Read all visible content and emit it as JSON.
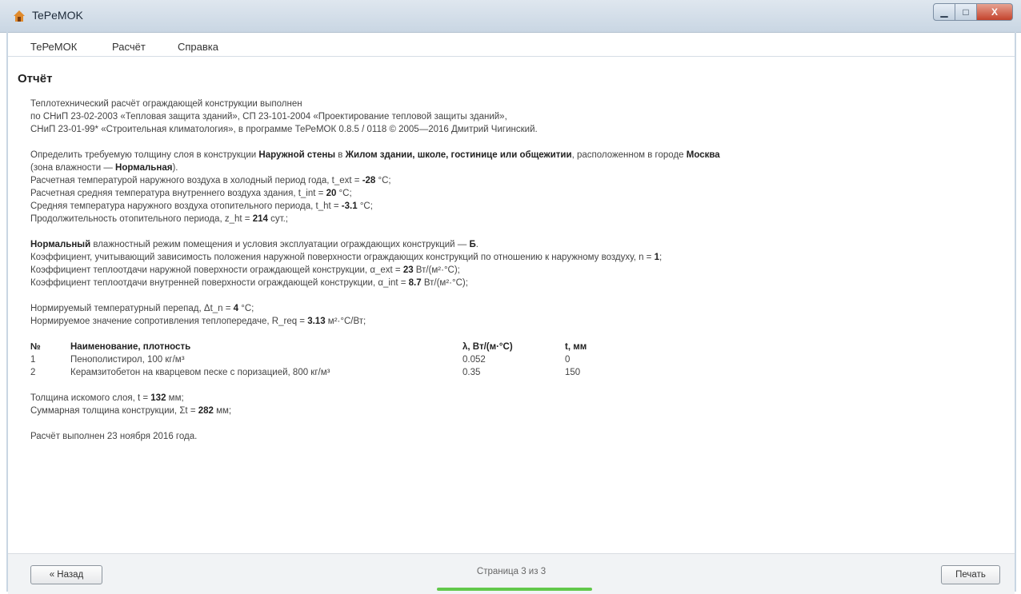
{
  "window": {
    "title": "TePeMOK",
    "min_glyph": "▁",
    "max_glyph": "□",
    "close_glyph": "X"
  },
  "menu": [
    "ТеРеМОК",
    "Расчёт",
    "Справка"
  ],
  "page_title": "Отчёт",
  "report": {
    "intro": [
      "Теплотехнический расчёт ограждающей конструкции выполнен",
      "по СНиП 23-02-2003 «Тепловая защита зданий», СП 23-101-2004 «Проектирование тепловой защиты зданий»,",
      "СНиП 23-01-99* «Строительная климатология», в программе ТеРеМОК 0.8.5 / 0118 © 2005—2016 Дмитрий Чигинский."
    ],
    "task": {
      "t1": "Определить требуемую толщину слоя в конструкции ",
      "b1": "Наружной стены",
      "t2": " в ",
      "b2": "Жилом здании, школе, гостинице или общежитии",
      "t3": ", расположенном в городе ",
      "b3": "Москва"
    },
    "zone": {
      "t1": "(зона влажности — ",
      "b1": "Нормальная",
      "t2": ")."
    },
    "params": [
      {
        "pre": "Расчетная температурой наружного воздуха в холодный период года, t_ext = ",
        "val": "-28",
        "post": " °C;"
      },
      {
        "pre": "Расчетная средняя температура внутреннего воздуха здания, t_int = ",
        "val": "20",
        "post": " °C;"
      },
      {
        "pre": "Средняя температура наружного воздуха отопительного периода, t_ht = ",
        "val": "-3.1",
        "post": " °C;"
      },
      {
        "pre": "Продолжительность отопительного периода, z_ht = ",
        "val": "214",
        "post": " сут.;"
      }
    ],
    "humidity": {
      "b1": "Нормальный",
      "t1": " влажностный режим помещения и условия эксплуатации ограждающих конструкций — ",
      "b2": "Б",
      "t2": "."
    },
    "coeffs": [
      {
        "pre": "Коэффициент, учитывающий зависимость положения наружной поверхности ограждающих конструкций по отношению к наружному воздуху, n = ",
        "val": "1",
        "post": ";"
      },
      {
        "pre": "Коэффициент теплоотдачи наружной поверхности ограждающей конструкции, α_ext = ",
        "val": "23",
        "post": " Вт/(м²·°C);"
      },
      {
        "pre": "Коэффициент теплоотдачи внутренней поверхности ограждающей конструкции, α_int = ",
        "val": "8.7",
        "post": " Вт/(м²·°C);"
      }
    ],
    "norms": [
      {
        "pre": "Нормируемый температурный перепад, Δt_n = ",
        "val": "4",
        "post": " °C;"
      },
      {
        "pre": "Нормируемое значение сопротивления теплопередаче, R_req = ",
        "val": "3.13",
        "post": " м²·°C/Вт;"
      }
    ],
    "table": {
      "headers": [
        "№",
        "Наименование, плотность",
        "λ, Вт/(м·°C)",
        "t, мм"
      ],
      "rows": [
        [
          "1",
          "Пенополистирол, 100 кг/м³",
          "0.052",
          "0"
        ],
        [
          "2",
          "Керамзитобетон на кварцевом песке с поризацией, 800 кг/м³",
          "0.35",
          "150"
        ]
      ]
    },
    "results": [
      {
        "pre": "Толщина искомого слоя, t = ",
        "val": "132",
        "post": " мм;"
      },
      {
        "pre": "Суммарная толщина конструкции, Σt = ",
        "val": "282",
        "post": " мм;"
      }
    ],
    "done": "Расчёт выполнен 23 ноября 2016 года."
  },
  "footer": {
    "back_label": "« Назад",
    "page_indicator": "Страница 3 из 3",
    "print_label": "Печать"
  },
  "colors": {
    "progress": "#62c84b",
    "close_button": "#c4432c"
  }
}
